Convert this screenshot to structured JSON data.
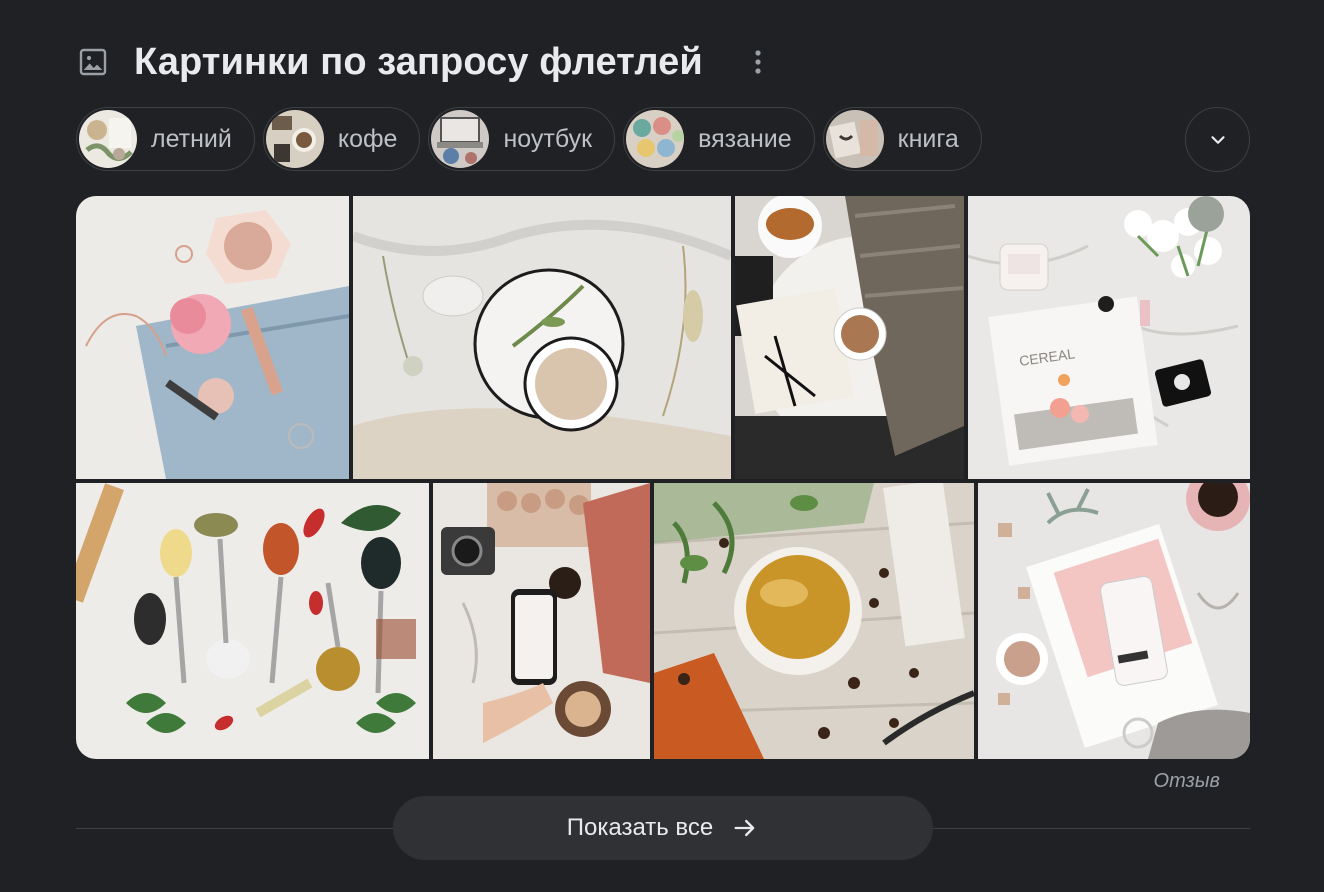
{
  "header": {
    "title": "Картинки по запросу флетлей",
    "icon": "image-icon",
    "more_icon": "more-vert-icon"
  },
  "chips": [
    {
      "label": "летний",
      "thumb_colors": [
        "#e9e6e0",
        "#8a9c7a",
        "#f1efe9"
      ]
    },
    {
      "label": "кофе",
      "thumb_colors": [
        "#d9d2c4",
        "#6b5b4a",
        "#a89980"
      ]
    },
    {
      "label": "ноутбук",
      "thumb_colors": [
        "#c9c5c2",
        "#5b7fa6",
        "#e3dfdb"
      ]
    },
    {
      "label": "вязание",
      "thumb_colors": [
        "#d8cfc4",
        "#6aa9a0",
        "#d98f86"
      ]
    },
    {
      "label": "книга",
      "thumb_colors": [
        "#c7bfb5",
        "#3d3a36",
        "#e1dad1"
      ]
    }
  ],
  "expand_icon": "chevron-down-icon",
  "feedback_label": "Отзыв",
  "show_all": {
    "label": "Показать все",
    "icon": "arrow-right-icon"
  },
  "colors": {
    "background": "#202124",
    "text": "#e8eaed",
    "chip_border": "#3c4043",
    "button_bg": "#303134"
  }
}
